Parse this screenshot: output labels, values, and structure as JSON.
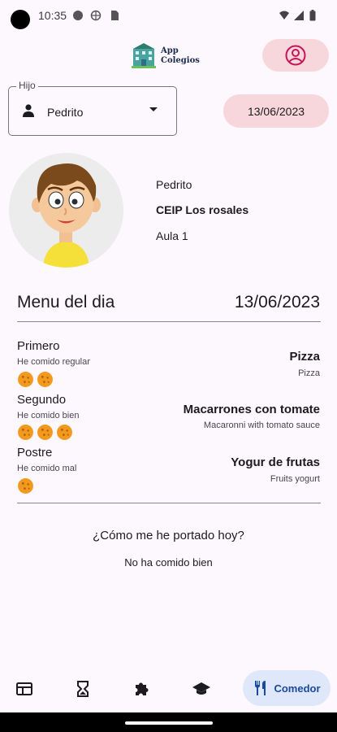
{
  "status_bar": {
    "time": "10:35"
  },
  "header": {
    "logo_text_line1": "App",
    "logo_text_line2": "Colegios"
  },
  "child_select": {
    "legend": "Hijo",
    "value": "Pedrito"
  },
  "date_button": {
    "label": "13/06/2023"
  },
  "child": {
    "name": "Pedrito",
    "school": "CEIP Los rosales",
    "class": "Aula 1"
  },
  "menu": {
    "title": "Menu del dia",
    "date": "13/06/2023",
    "courses": [
      {
        "course": "Primero",
        "note": "He comido regular",
        "rating": 2,
        "dish": "Pizza",
        "dish_sub": "Pizza"
      },
      {
        "course": "Segundo",
        "note": "He comido bien",
        "rating": 3,
        "dish": "Macarrones con tomate",
        "dish_sub": "Macaronni with tomato sauce"
      },
      {
        "course": "Postre",
        "note": "He comido mal",
        "rating": 1,
        "dish": "Yogur de frutas",
        "dish_sub": "Fruits yogurt"
      }
    ]
  },
  "behavior": {
    "question": "¿Cómo me he portado hoy?",
    "answer": "No ha comido bien"
  },
  "bottom_nav": {
    "items": [
      {
        "icon": "newspaper-icon"
      },
      {
        "icon": "hourglass-icon"
      },
      {
        "icon": "puzzle-icon"
      },
      {
        "icon": "graduation-cap-icon"
      },
      {
        "icon": "fork-knife-icon",
        "label": "Comedor",
        "active": true
      }
    ]
  },
  "colors": {
    "accent_pink": "#f8d7dc",
    "profile_icon": "#c2185b",
    "cookie": "#f29a1e",
    "nav_active_bg": "#dfe7fb",
    "nav_active_text": "#1a4aa0"
  }
}
